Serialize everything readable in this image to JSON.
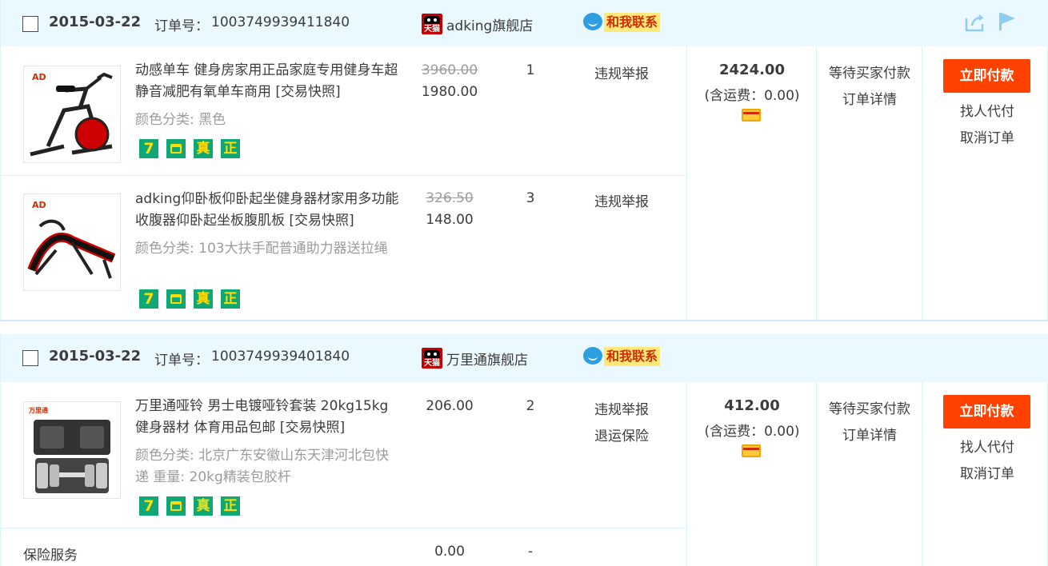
{
  "orders": [
    {
      "date": "2015-03-22",
      "order_no_label": "订单号：",
      "order_no": "1003749939411840",
      "shop_badge": "天猫",
      "shop_name": "adking旗舰店",
      "contact_label": "和我联系",
      "items": [
        {
          "title": "动感单车 健身房家用正品家庭专用健身车超静音减肥有氧单车商用 [交易快照]",
          "spec": "颜色分类: 黑色",
          "price_old": "3960.00",
          "price_new": "1980.00",
          "qty": "1",
          "action": "违规举报"
        },
        {
          "title": "adking仰卧板仰卧起坐健身器材家用多功能收腹器仰卧起坐板腹肌板 [交易快照]",
          "spec": "颜色分类: 103大扶手配普通助力器送拉绳",
          "price_old": "326.50",
          "price_new": "148.00",
          "qty": "3",
          "action": "违规举报"
        }
      ],
      "total": "2424.00",
      "shipping": "(含运费：0.00)",
      "status": "等待买家付款",
      "detail_link": "订单详情",
      "pay_button": "立即付款",
      "proxy_link": "找人代付",
      "cancel_link": "取消订单"
    },
    {
      "date": "2015-03-22",
      "order_no_label": "订单号：",
      "order_no": "1003749939401840",
      "shop_badge": "天猫",
      "shop_name": "万里通旗舰店",
      "contact_label": "和我联系",
      "items": [
        {
          "title": "万里通哑铃 男士电镀哑铃套装 20kg15kg健身器材 体育用品包邮 [交易快照]",
          "spec": "颜色分类: 北京广东安徽山东天津河北包快递 重量: 20kg精装包胶杆",
          "price_new": "206.00",
          "qty": "2",
          "action": "违规举报",
          "action2": "退运保险"
        }
      ],
      "insurance": {
        "label": "保险服务",
        "price": "0.00",
        "qty": "-"
      },
      "total": "412.00",
      "shipping": "(含运费：0.00)",
      "status": "等待买家付款",
      "detail_link": "订单详情",
      "pay_button": "立即付款",
      "proxy_link": "找人代付",
      "cancel_link": "取消订单"
    }
  ],
  "badges": {
    "seven": "7",
    "zhen": "真",
    "zheng": "正"
  },
  "thumb_text": {
    "adking_logo": "AD",
    "wanlitong_logo": "万里通"
  },
  "icons": {
    "share": "share-icon",
    "flag": "flag-icon",
    "card": "card-icon",
    "bag": "bag-icon",
    "tmall": "tmall-icon",
    "chat": "chat-bubble-icon"
  },
  "colors": {
    "header_bg": "#eaf8ff",
    "pay_button": "#ff4200",
    "badge_green": "#0fa775",
    "border": "#daf3ff"
  }
}
